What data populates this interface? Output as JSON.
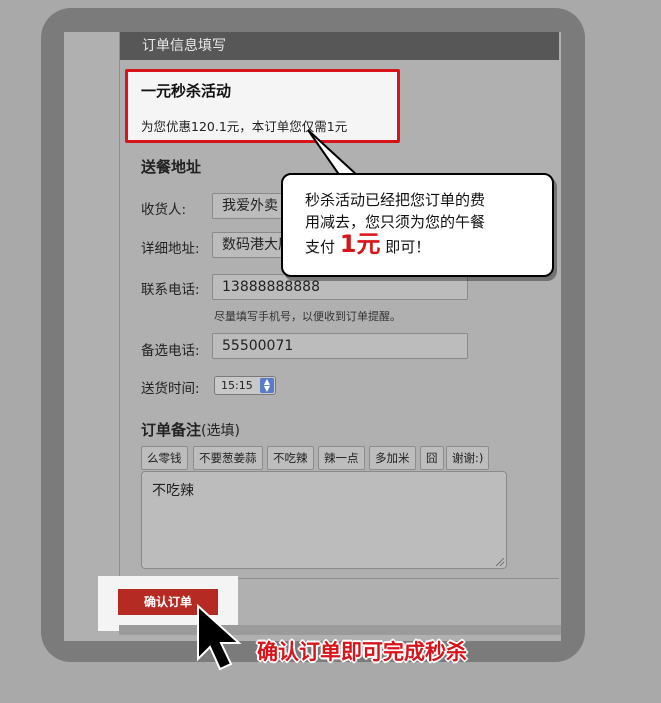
{
  "panel": {
    "header_title": "订单信息填写"
  },
  "promo": {
    "title": "一元秒杀活动",
    "text": "为您优惠120.1元，本订单您仅需1元"
  },
  "address_section": {
    "title": "送餐地址",
    "receiver": {
      "label": "收货人:",
      "value": "我爱外卖"
    },
    "address": {
      "label": "详细地址:",
      "value": "数码港大厦"
    },
    "phone": {
      "label": "联系电话:",
      "value": "13888888888",
      "hint": "尽量填写手机号，以便收到订单提醒。"
    },
    "alt_phone": {
      "label": "备选电话:",
      "value": "55500071"
    },
    "delivery_time": {
      "label": "送货时间:",
      "value": "15:15"
    }
  },
  "notes_section": {
    "title": "订单备注",
    "subtitle": "(选填)",
    "chips": [
      "么零钱",
      "不要葱姜蒜",
      "不吃辣",
      "辣一点",
      "多加米",
      "囧",
      "谢谢:)"
    ],
    "text": "不吃辣"
  },
  "confirm_button": "确认订单",
  "bubble": {
    "line1": "秒杀活动已经把您订单的费",
    "line2": "用减去，您只须为您的午餐",
    "line3_pre": "支付",
    "line3_big": "1元",
    "line3_post": "即可！"
  },
  "callout": "确认订单即可完成秒杀",
  "colors": {
    "accent_red": "#d7141a",
    "button_red": "#b52a22",
    "header_bg": "#575757"
  },
  "icons": {
    "cursor": "arrow-cursor-icon",
    "select": "stepper-arrows-icon"
  }
}
